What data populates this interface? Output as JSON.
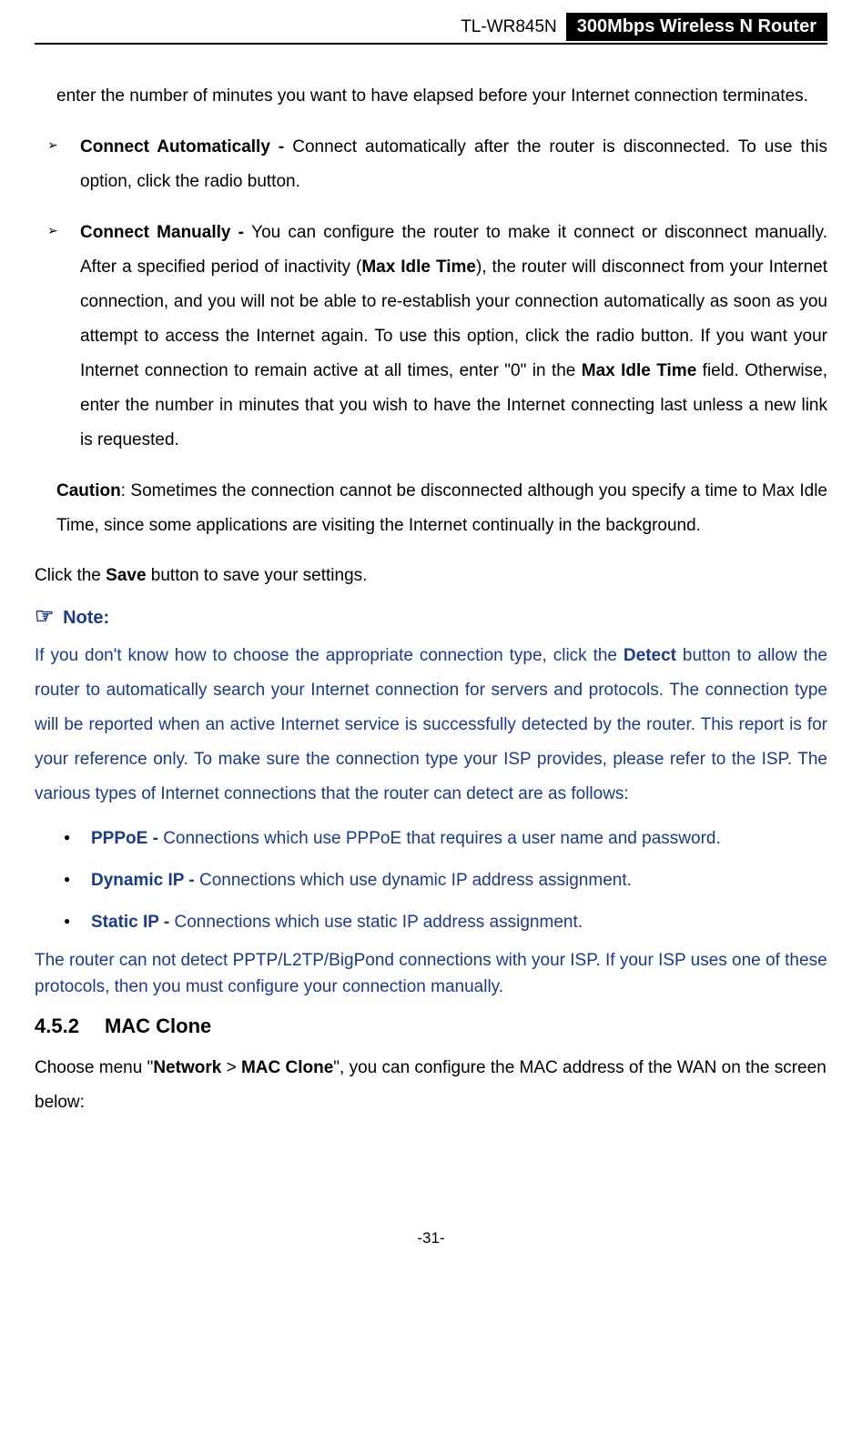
{
  "header": {
    "model": "TL-WR845N",
    "title": "300Mbps Wireless N Router"
  },
  "continuedText": "enter the number of minutes you want to have elapsed before your Internet connection terminates.",
  "bullets": [
    {
      "label": "Connect Automatically - ",
      "text": "Connect automatically after the router is disconnected. To use this option, click the radio button."
    },
    {
      "label": "Connect Manually - ",
      "text1": "You can configure the router to make it connect or disconnect manually. After a specified period of inactivity (",
      "boldA": "Max Idle Time",
      "text2": "), the router will disconnect from your Internet connection, and you will not be able to re-establish your connection automatically as soon as you attempt to access the Internet again. To use this option, click the radio button. If you want your Internet connection to remain active at all times, enter \"0\" in the ",
      "boldB": "Max Idle Time",
      "text3": " field. Otherwise, enter the number in minutes that you wish to have the Internet connecting last unless a new link is requested."
    }
  ],
  "caution": {
    "label": "Caution",
    "text": ": Sometimes the connection cannot be disconnected although you specify a time to Max Idle Time, since some applications are visiting the Internet continually in the background."
  },
  "saveLine": {
    "pre": "Click the ",
    "bold": "Save",
    "post": " button to save your settings."
  },
  "noteHeading": "Note:",
  "noteBody": {
    "pre": "If you don't know how to choose the appropriate connection type, click the ",
    "bold": "Detect",
    "post": " button to allow the router to automatically search your Internet connection for servers and protocols. The connection type will be reported when an active Internet service is successfully detected by the router. This report is for your reference only. To make sure the connection type your ISP provides, please refer to the ISP. The various types of Internet connections that the router can detect are as follows:"
  },
  "discList": [
    {
      "label": "PPPoE - ",
      "text": "Connections which use PPPoE that requires a user name and password."
    },
    {
      "label": "Dynamic IP - ",
      "text": "Connections which use dynamic IP address assignment."
    },
    {
      "label": "Static IP - ",
      "text": "Connections which use static IP address assignment."
    }
  ],
  "noteTail": "The router can not detect PPTP/L2TP/BigPond connections with your ISP. If your ISP uses one of these protocols, then you must configure your connection manually.",
  "section": {
    "number": "4.5.2",
    "title": "MAC Clone"
  },
  "sectionIntro": {
    "pre": "Choose menu \"",
    "boldA": "Network",
    "gt": " > ",
    "boldB": "MAC Clone",
    "post": "\", you can configure the MAC address of the WAN on the screen below:"
  },
  "pageNum": "-31-"
}
